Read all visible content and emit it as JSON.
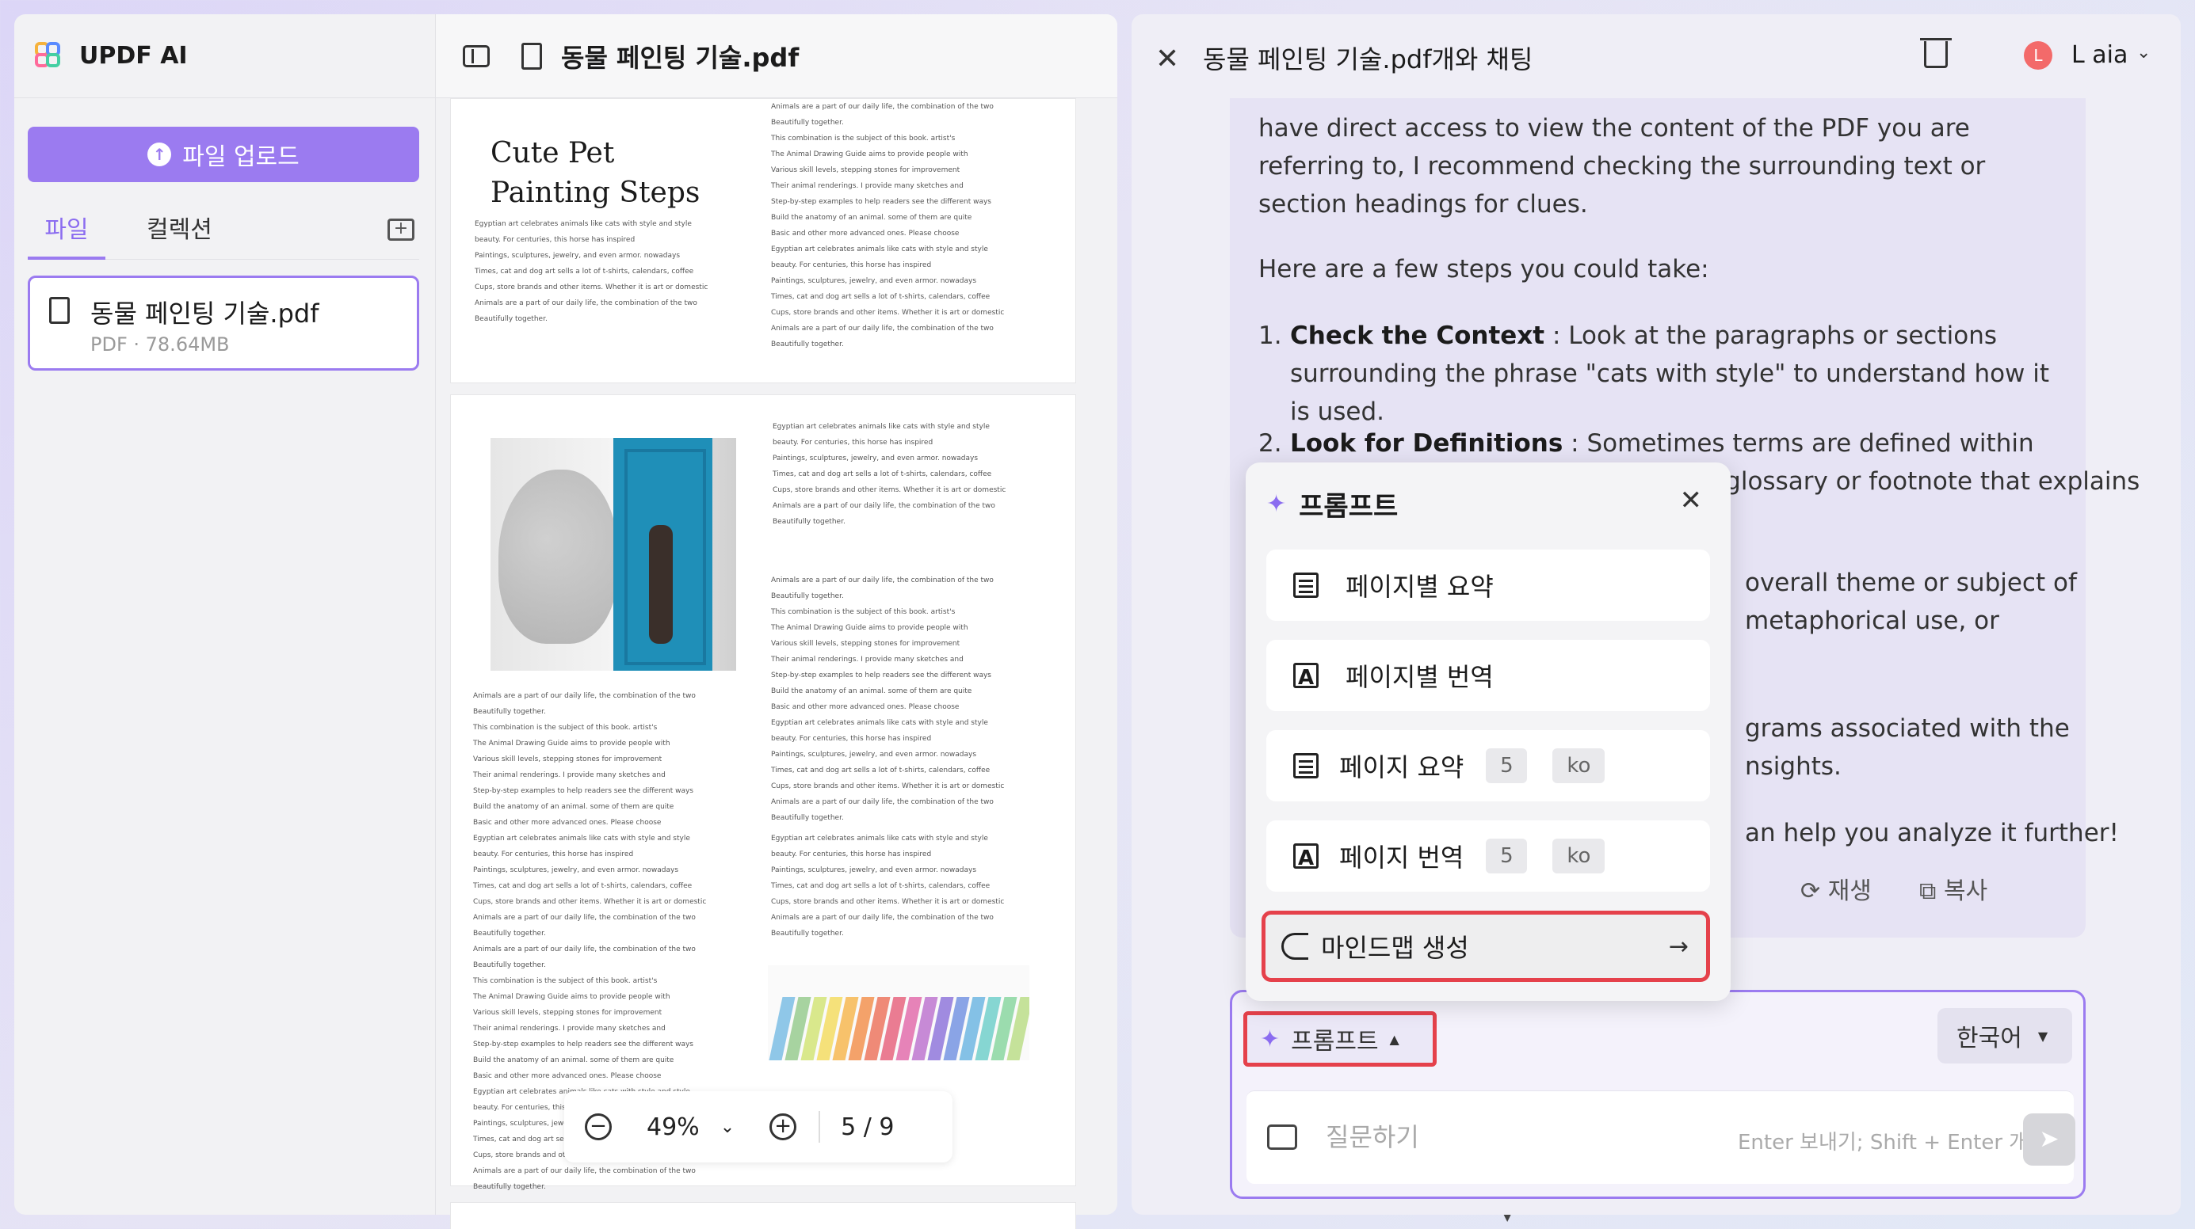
{
  "sidebar": {
    "app_name": "UPDF AI",
    "upload_label": "파일 업로드",
    "tabs": [
      "파일",
      "컬렉션"
    ],
    "file": {
      "name": "동물 페인팅 기술.pdf",
      "meta": "PDF · 78.64MB"
    }
  },
  "viewer": {
    "title": "동물 페인팅 기술.pdf",
    "page1_title": "Cute Pet Painting Steps",
    "zoom": "49%",
    "page_indicator": "5 / 9",
    "body_text": "Egyptian art celebrates animals like cats with style and style\nbeauty. For centuries, this horse has inspired\nPaintings, sculptures, jewelry, and even armor. nowadays\nTimes, cat and dog art sells a lot of t-shirts, calendars, coffee\nCups, store brands and other items. Whether it is art or domestic\nAnimals are a part of our daily life, the combination of the two\nBeautifully together.",
    "body_text_long": "Animals are a part of our daily life, the combination of the two\nBeautifully together.\nThis combination is the subject of this book. artist's\nThe Animal Drawing Guide aims to provide people with\nVarious skill levels, stepping stones for improvement\nTheir animal renderings. I provide many sketches and\nStep-by-step examples to help readers see the different ways\nBuild the anatomy of an animal. some of them are quite\nBasic and other more advanced ones. Please choose\nEgyptian art celebrates animals like cats with style and style\nbeauty. For centuries, this horse has inspired\nPaintings, sculptures, jewelry, and even armor. nowadays\nTimes, cat and dog art sells a lot of t-shirts, calendars, coffee\nCups, store brands and other items. Whether it is art or domestic\nAnimals are a part of our daily life, the combination of the two\nBeautifully together."
  },
  "chat": {
    "title": "동물 페인팅 기술.pdf개와 채팅",
    "user_initial": "L",
    "user_name": "L aia",
    "message": {
      "p1": "have direct access to view the content of the PDF you are referring to, I recommend checking the surrounding text or section headings for clues.",
      "p2": "Here are a few steps you could take:",
      "step1_num": "1.",
      "step1_title": "Check the Context",
      "step1_text": " : Look at the paragraphs or sections surrounding the phrase \"cats with style\" to understand how it is used.",
      "step2_num": "2.",
      "step2_title": "Look for Definitions",
      "step2_text": " : Sometimes terms are defined within the",
      "frag_line": "document itself. Check if there is a glossary or footnote that explains",
      "frag_a1": "overall theme or subject of",
      "frag_a2": "metaphorical use, or",
      "frag_b1": "grams associated with the",
      "frag_b2": "nsights.",
      "frag_c1": "an help you analyze it further!"
    },
    "regen_label": "재생",
    "copy_label": "복사",
    "prompt_label": "프롬프트",
    "language": "한국어",
    "input_placeholder": "질문하기",
    "hint": "Enter 보내기; Shift + Enter 개행"
  },
  "prompt_popup": {
    "title": "프롬프트",
    "items": [
      {
        "label": "페이지별 요약"
      },
      {
        "label": "페이지별 번역"
      },
      {
        "label": "페이지 요약",
        "pages": "5",
        "lang": "ko"
      },
      {
        "label": "페이지 번역",
        "pages": "5",
        "lang": "ko"
      },
      {
        "label": "마인드맵 생성"
      }
    ]
  },
  "colors": {
    "accent": "#9b7bf0",
    "highlight": "#e5414b"
  }
}
